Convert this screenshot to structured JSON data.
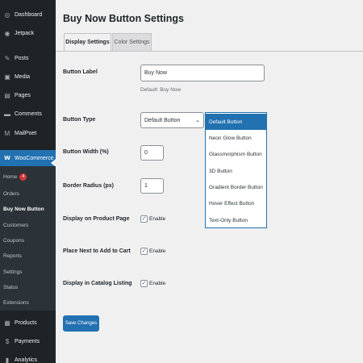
{
  "sidebar": {
    "items": [
      {
        "label": "Dashboard",
        "icon": "dashboard-icon",
        "glyph": "◎"
      },
      {
        "label": "Jetpack",
        "icon": "jetpack-icon",
        "glyph": "◉"
      },
      {
        "label": "Posts",
        "icon": "pin-icon",
        "glyph": "✎"
      },
      {
        "label": "Media",
        "icon": "media-icon",
        "glyph": "▣"
      },
      {
        "label": "Pages",
        "icon": "pages-icon",
        "glyph": "▤"
      },
      {
        "label": "Comments",
        "icon": "comment-icon",
        "glyph": "▬"
      },
      {
        "label": "MailPoet",
        "icon": "mailpoet-icon",
        "glyph": "M"
      },
      {
        "label": "WooCommerce",
        "icon": "woocommerce-icon",
        "glyph": "W"
      },
      {
        "label": "Products",
        "icon": "products-icon",
        "glyph": "▦"
      },
      {
        "label": "Payments",
        "icon": "payments-icon",
        "glyph": "$"
      },
      {
        "label": "Analytics",
        "icon": "analytics-icon",
        "glyph": "▮"
      }
    ],
    "woo_submenu": [
      {
        "label": "Home",
        "badge": "4"
      },
      {
        "label": "Orders"
      },
      {
        "label": "Buy Now Button"
      },
      {
        "label": "Customers"
      },
      {
        "label": "Coupons"
      },
      {
        "label": "Reports"
      },
      {
        "label": "Settings"
      },
      {
        "label": "Status"
      },
      {
        "label": "Extensions"
      }
    ],
    "active_color": "#2271b1"
  },
  "page": {
    "title": "Buy Now Button Settings",
    "tabs": [
      {
        "label": "Display Settings",
        "active": true
      },
      {
        "label": "Color Settings",
        "active": false
      }
    ]
  },
  "form": {
    "button_label": {
      "label": "Button Label",
      "value": "Buy Now",
      "description": "Default: Buy Now"
    },
    "button_type": {
      "label": "Button Type",
      "value": "Default Button",
      "options": [
        "Default Button",
        "Neon Glow Button",
        "Glassmorphism Button",
        "3D Button",
        "Gradient Border Button",
        "Hover Effect Button",
        "Text-Only Button"
      ],
      "highlighted": "Default Button"
    },
    "button_width": {
      "label": "Button Width (%)",
      "value": "0"
    },
    "border_radius": {
      "label": "Border Radius (px)",
      "value": "1"
    },
    "display_product_page": {
      "label": "Display on Product Page",
      "checkbox_label": "Enable",
      "checked": true
    },
    "place_next_cart": {
      "label": "Place Next to Add to Cart",
      "checkbox_label": "Enable",
      "checked": true
    },
    "display_catalog": {
      "label": "Display in Catalog Listing",
      "checkbox_label": "Enable",
      "checked": true
    },
    "save_label": "Save Changes"
  }
}
